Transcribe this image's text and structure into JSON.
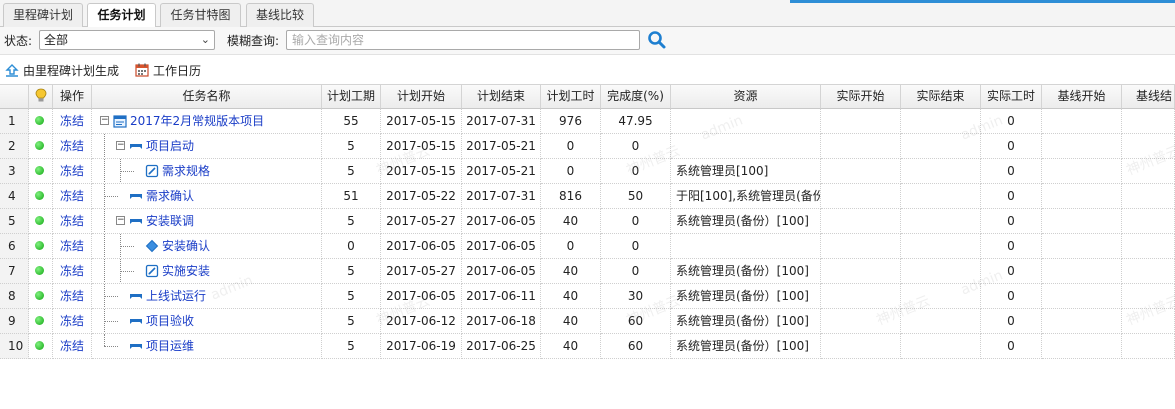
{
  "tabs": [
    {
      "label": "里程碑计划",
      "active": false
    },
    {
      "label": "任务计划",
      "active": true
    },
    {
      "label": "任务甘特图",
      "active": false
    },
    {
      "label": "基线比较",
      "active": false
    }
  ],
  "filter": {
    "status_label": "状态:",
    "status_value": "全部",
    "search_label": "模糊查询:",
    "search_placeholder": "输入查询内容"
  },
  "toolbar": {
    "generate_label": "由里程碑计划生成",
    "calendar_label": "工作日历"
  },
  "columns": [
    "",
    "",
    "操作",
    "任务名称",
    "计划工期",
    "计划开始",
    "计划结束",
    "计划工时",
    "完成度(%)",
    "资源",
    "实际开始",
    "实际结束",
    "实际工时",
    "基线开始",
    "基线结"
  ],
  "rows": [
    {
      "num": "1",
      "op": "冻结",
      "name": "2017年2月常规版本项目",
      "icon": "project-icon",
      "duration": "55",
      "start": "2017-05-15",
      "end": "2017-07-31",
      "hours": "976",
      "progress": "47.95",
      "resource": "",
      "actual_hours": "0"
    },
    {
      "num": "2",
      "op": "冻结",
      "name": "项目启动",
      "icon": "summary-task-icon",
      "duration": "5",
      "start": "2017-05-15",
      "end": "2017-05-21",
      "hours": "0",
      "progress": "0",
      "resource": "",
      "actual_hours": "0"
    },
    {
      "num": "3",
      "op": "冻结",
      "name": "需求规格",
      "icon": "task-icon",
      "duration": "5",
      "start": "2017-05-15",
      "end": "2017-05-21",
      "hours": "0",
      "progress": "0",
      "resource": "系统管理员[100]",
      "actual_hours": "0"
    },
    {
      "num": "4",
      "op": "冻结",
      "name": "需求确认",
      "icon": "summary-task-icon",
      "duration": "51",
      "start": "2017-05-22",
      "end": "2017-07-31",
      "hours": "816",
      "progress": "50",
      "resource": "于阳[100],系统管理员(备份",
      "actual_hours": "0"
    },
    {
      "num": "5",
      "op": "冻结",
      "name": "安装联调",
      "icon": "summary-task-icon",
      "duration": "5",
      "start": "2017-05-27",
      "end": "2017-06-05",
      "hours": "40",
      "progress": "0",
      "resource": "系统管理员(备份）[100]",
      "actual_hours": "0"
    },
    {
      "num": "6",
      "op": "冻结",
      "name": "安装确认",
      "icon": "milestone-icon",
      "duration": "0",
      "start": "2017-06-05",
      "end": "2017-06-05",
      "hours": "0",
      "progress": "0",
      "resource": "",
      "actual_hours": "0"
    },
    {
      "num": "7",
      "op": "冻结",
      "name": "实施安装",
      "icon": "task-icon",
      "duration": "5",
      "start": "2017-05-27",
      "end": "2017-06-05",
      "hours": "40",
      "progress": "0",
      "resource": "系统管理员(备份）[100]",
      "actual_hours": "0"
    },
    {
      "num": "8",
      "op": "冻结",
      "name": "上线试运行",
      "icon": "summary-task-icon",
      "duration": "5",
      "start": "2017-06-05",
      "end": "2017-06-11",
      "hours": "40",
      "progress": "30",
      "resource": "系统管理员(备份）[100]",
      "actual_hours": "0"
    },
    {
      "num": "9",
      "op": "冻结",
      "name": "项目验收",
      "icon": "summary-task-icon",
      "duration": "5",
      "start": "2017-06-12",
      "end": "2017-06-18",
      "hours": "40",
      "progress": "60",
      "resource": "系统管理员(备份）[100]",
      "actual_hours": "0"
    },
    {
      "num": "10",
      "op": "冻结",
      "name": "项目运维",
      "icon": "summary-task-icon",
      "duration": "5",
      "start": "2017-06-19",
      "end": "2017-06-25",
      "hours": "40",
      "progress": "60",
      "resource": "系统管理员(备份）[100]",
      "actual_hours": "0"
    }
  ],
  "watermark": {
    "company": "神州普云",
    "user": "admin"
  },
  "colors": {
    "accent": "#2e8ed6",
    "link": "#1a3dc7",
    "status_green": "#12a812"
  }
}
